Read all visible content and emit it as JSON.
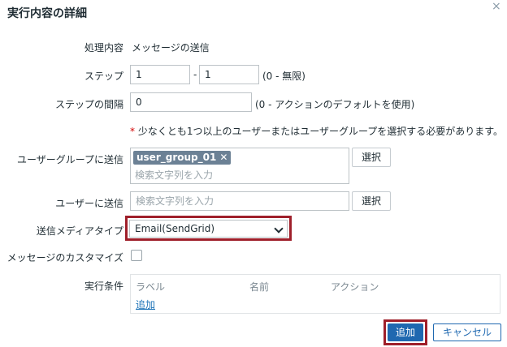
{
  "dialog": {
    "title": "実行内容の詳細",
    "close_glyph": "×"
  },
  "operation": {
    "label": "処理内容",
    "value": "メッセージの送信"
  },
  "steps": {
    "label": "ステップ",
    "from": "1",
    "separator": "-",
    "to": "1",
    "hint": "(0 - 無限)"
  },
  "step_duration": {
    "label": "ステップの間隔",
    "value": "0",
    "hint": "(0 - アクションのデフォルトを使用)"
  },
  "notice": {
    "asterisk": "*",
    "text": " 少なくとも1つ以上のユーザーまたはユーザーグループを選択する必要があります。"
  },
  "user_groups": {
    "label": "ユーザーグループに送信",
    "tags": [
      "user_group_01"
    ],
    "remove_glyph": "✕",
    "placeholder": "検索文字列を入力",
    "select_label": "選択"
  },
  "users": {
    "label": "ユーザーに送信",
    "placeholder": "検索文字列を入力",
    "select_label": "選択"
  },
  "media_type": {
    "label": "送信メディアタイプ",
    "selected": "Email(SendGrid)"
  },
  "custom_message": {
    "label": "メッセージのカスタマイズ",
    "checked": false
  },
  "conditions": {
    "label": "実行条件",
    "columns": [
      "ラベル",
      "名前",
      "アクション"
    ],
    "add_link": "追加"
  },
  "footer": {
    "add_label": "追加",
    "cancel_label": "キャンセル"
  },
  "colors": {
    "highlight": "#9f1f2a",
    "primary": "#1f68b0",
    "tag": "#6c8195"
  }
}
